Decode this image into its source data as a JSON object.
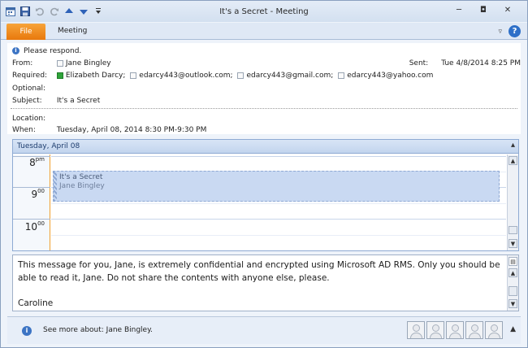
{
  "window": {
    "title": "It's a Secret - Meeting"
  },
  "qat": {
    "icons": [
      "calendar-icon",
      "save-icon",
      "undo-icon",
      "redo-icon",
      "up-arrow-icon",
      "down-arrow-icon",
      "customize-icon"
    ]
  },
  "window_controls": {
    "minimize": "─",
    "restore": "◘",
    "close": "✕"
  },
  "ribbon": {
    "tabs": [
      "File",
      "Meeting"
    ],
    "collapse": "▿",
    "help": "?"
  },
  "header": {
    "notice": "Please respond.",
    "from_label": "From:",
    "from_value": "Jane Bingley",
    "sent_label": "Sent:",
    "sent_value": "Tue 4/8/2014 8:25 PM",
    "required_label": "Required:",
    "required": [
      "Elizabeth Darcy;",
      "edarcy443@outlook.com;",
      "edarcy443@gmail.com;",
      "edarcy443@yahoo.com"
    ],
    "optional_label": "Optional:",
    "subject_label": "Subject:",
    "subject_value": "It's a Secret",
    "location_label": "Location:",
    "when_label": "When:",
    "when_value": "Tuesday, April 08, 2014 8:30 PM-9:30 PM"
  },
  "calendar": {
    "date": "Tuesday, April 08",
    "times": [
      {
        "hour": "8",
        "suffix": "pm"
      },
      {
        "hour": "9",
        "suffix": "00"
      },
      {
        "hour": "10",
        "suffix": "00"
      }
    ],
    "appointment": {
      "title": "It's a Secret",
      "organizer": "Jane Bingley"
    }
  },
  "body": {
    "line1": "This message for you, Jane, is extremely confidential and encrypted using Microsoft AD RMS. Only you should be",
    "line2": "able to read it, Jane. Do not share the contents with anyone else, please.",
    "signature": "Caroline"
  },
  "people_pane": {
    "text": "See more about: Jane Bingley.",
    "avatar_count": 5
  },
  "colors": {
    "file_tab": "#e8780c",
    "accent": "#2d6fc8",
    "appointment": "#c9d9f2",
    "time_divider": "#f0a030"
  }
}
